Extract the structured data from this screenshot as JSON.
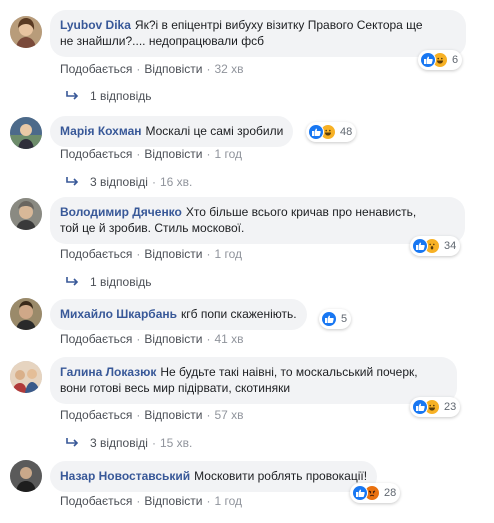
{
  "actions": {
    "like_label": "Подобається",
    "reply_label": "Відповісти"
  },
  "comments": [
    {
      "author": "Lyubov Dika",
      "text_line1": "Як?і в епіцентрі вибуху візитку Правого Сектора ще",
      "text_line2": "не знайшли?.... недопрацювали фсб",
      "reaction_count": "6",
      "reactions": [
        "like",
        "haha"
      ],
      "time": "32 хв",
      "replies": {
        "label": "1 відповідь",
        "time": ""
      }
    },
    {
      "author": "Марія Кохман",
      "text_line1": "Москалі це самі зробили",
      "reaction_count": "48",
      "reactions": [
        "like",
        "haha"
      ],
      "time": "1 год",
      "replies": {
        "label": "3 відповіді",
        "time": "16 хв."
      }
    },
    {
      "author": "Володимир Дяченко",
      "text_line1": "Хто більше всього кричав про ненависть,",
      "text_line2": "той це й зробив. Стиль москової.",
      "reaction_count": "34",
      "reactions": [
        "like",
        "wow"
      ],
      "time": "1 год",
      "replies": {
        "label": "1 відповідь",
        "time": ""
      }
    },
    {
      "author": "Михайло Шкарбань",
      "text_line1": "кгб попи скаженіють.",
      "reaction_count": "5",
      "reactions": [
        "like"
      ],
      "time": "41 хв",
      "replies": null
    },
    {
      "author": "Галина Локазюк",
      "text_line1": "Не будьте такі наівні, то москальський почерк,",
      "text_line2": "вони готові весь мир підірвати, скотиняки",
      "reaction_count": "23",
      "reactions": [
        "like",
        "haha"
      ],
      "time": "57 хв",
      "replies": {
        "label": "3 відповіді",
        "time": "15 хв."
      }
    },
    {
      "author": "Назар Новоставський",
      "text_line1": "Московити роблять провокації!",
      "reaction_count": "28",
      "reactions": [
        "like",
        "angry"
      ],
      "time": "1 год",
      "replies": null
    }
  ],
  "colors": {
    "link": "#385898",
    "bubble": "#f2f3f5",
    "like": "#1877f2",
    "haha": "#f7b125",
    "angry": "#e9710f"
  }
}
